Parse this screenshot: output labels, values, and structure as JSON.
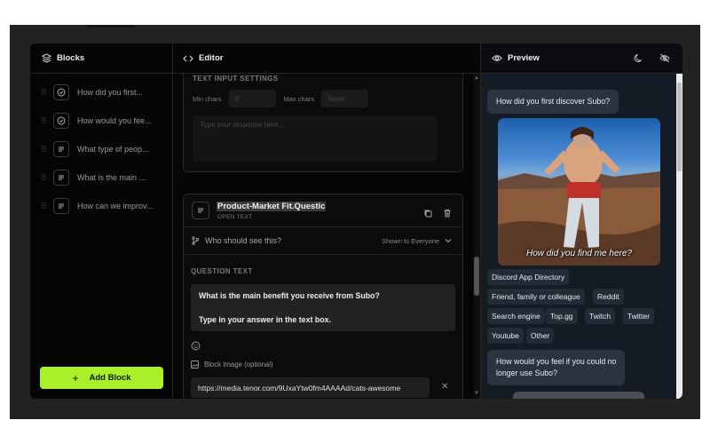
{
  "blocks_panel": {
    "title": "Blocks",
    "items": [
      {
        "label": "How did you first...",
        "icon": "check-circle-icon"
      },
      {
        "label": "How would you fee...",
        "icon": "check-circle-icon"
      },
      {
        "label": "What type of peop...",
        "icon": "text-lines-icon"
      },
      {
        "label": "What is the main ...",
        "icon": "text-lines-icon"
      },
      {
        "label": "How can we improv...",
        "icon": "text-lines-icon"
      }
    ],
    "add_button": "Add Block",
    "add_button_color": "#a9f02a"
  },
  "editor": {
    "title": "Editor",
    "text_input_settings": {
      "section_title": "TEXT INPUT SETTINGS",
      "min_label": "Min chars",
      "min_placeholder": "0",
      "max_label": "Max chars",
      "max_placeholder": "None",
      "response_placeholder": "Type your response here..."
    },
    "question_block": {
      "title": "Product-Market Fit.Questic",
      "subtitle": "OPEN TEXT",
      "visibility_label": "Who should see this?",
      "visibility_value": "Shown to Everyone",
      "question_section": "QUESTION TEXT",
      "question_line1": "What is the main benefit you receive from Subo?",
      "question_line2": "Type in your answer in the text box.",
      "image_label": "Block Image (optional)",
      "image_url": "https://media.tenor.com/9UxaYtw0fm4AAAAd/cats-awesome"
    }
  },
  "preview": {
    "title": "Preview",
    "message1": "How did you first discover Subo?",
    "gif_caption": "How did you find me here?",
    "options": [
      "Discord App Directory",
      "Friend, family or colleague",
      "Reddit",
      "Search engine",
      "Top.gg",
      "Twitch",
      "Twitter",
      "Youtube",
      "Other"
    ],
    "message2_line1": "How would you feel if you could no",
    "message2_line2": "longer use Subo?"
  }
}
